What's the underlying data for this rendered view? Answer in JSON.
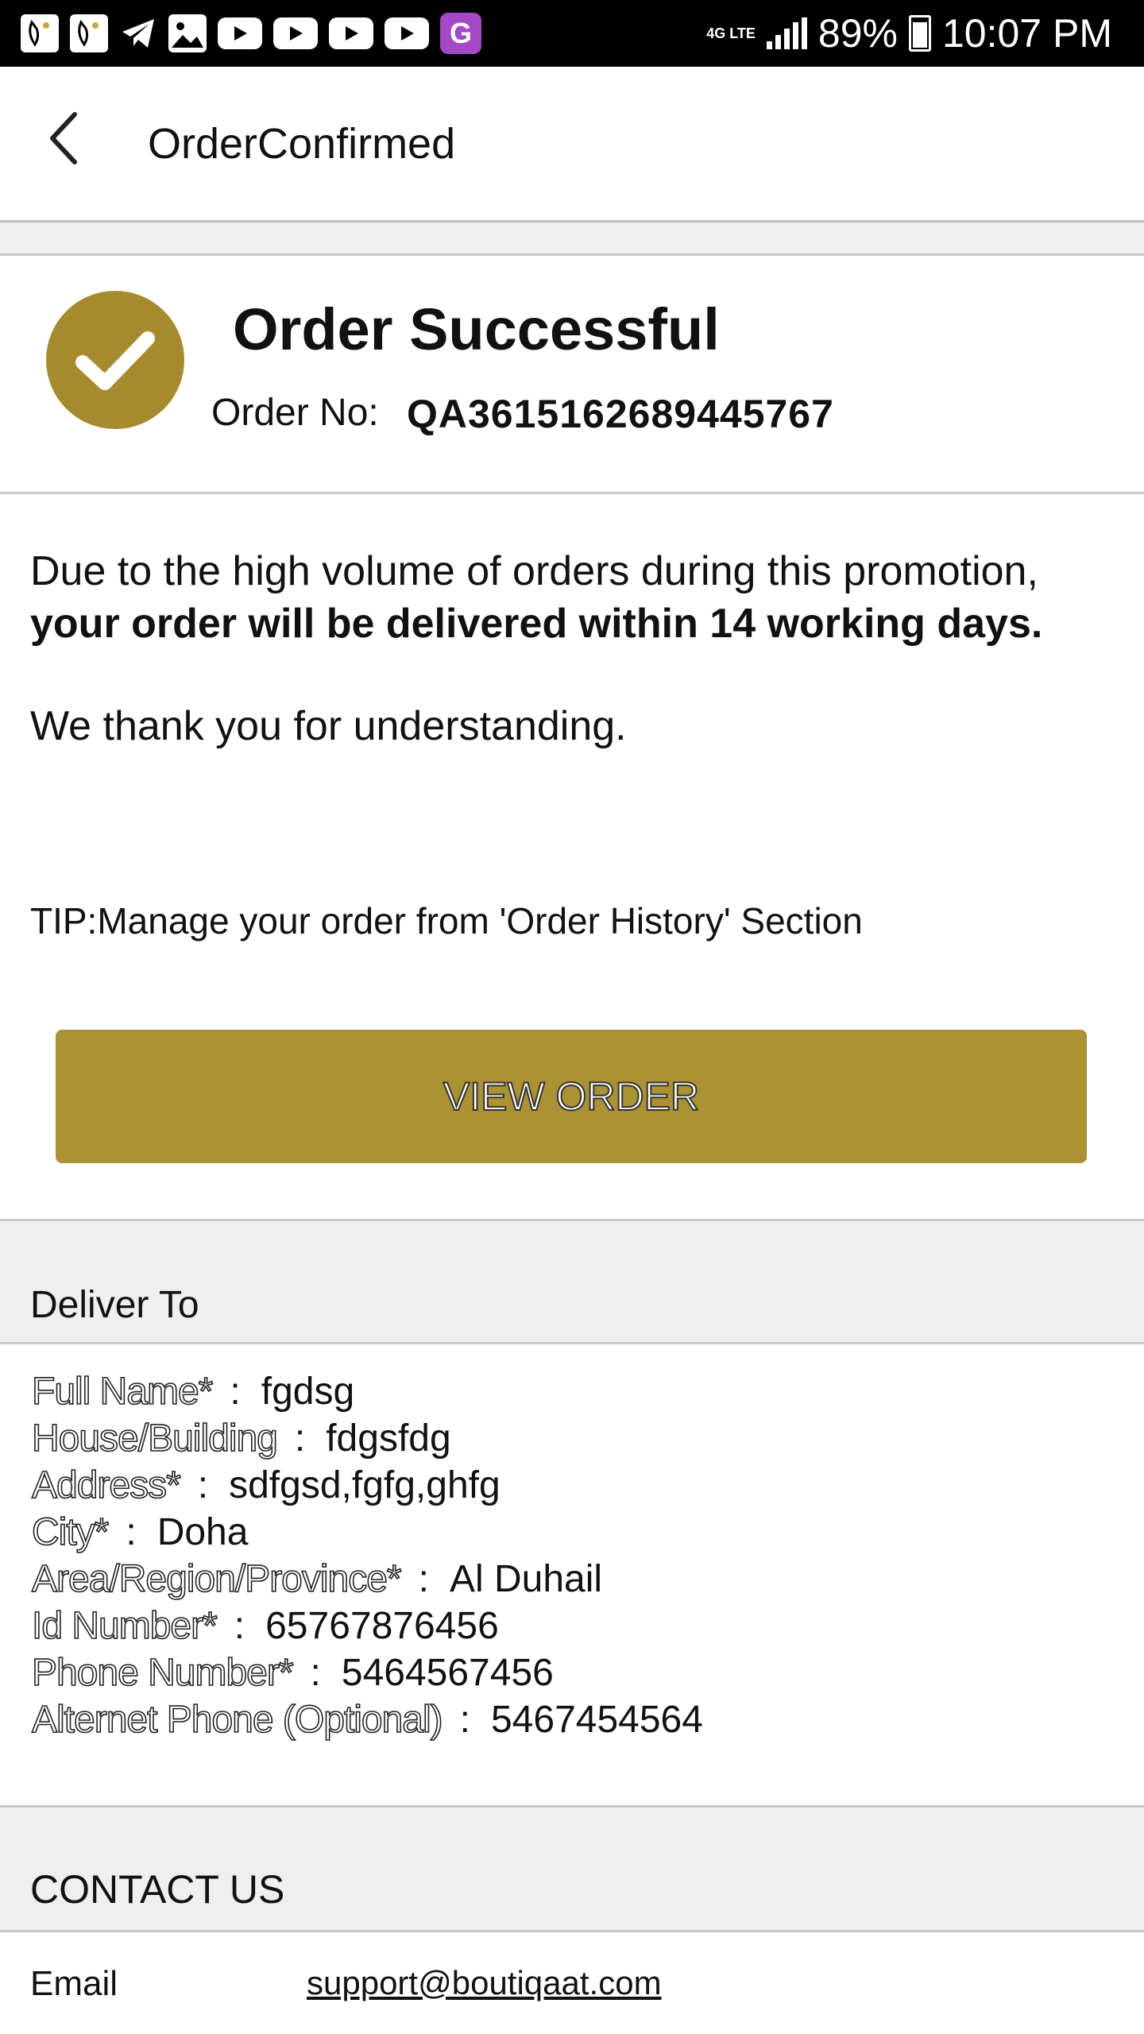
{
  "status_bar": {
    "left_icons": [
      "boutiqaat-app-icon",
      "boutiqaat-app-icon",
      "telegram-icon",
      "gallery-icon",
      "youtube-icon",
      "youtube-icon",
      "youtube-icon",
      "youtube-icon",
      "g-app-icon"
    ],
    "network": "4G LTE",
    "battery": "89%",
    "time": "10:07 PM"
  },
  "appbar": {
    "title": "OrderConfirmed",
    "back_icon": "back-arrow-icon"
  },
  "success": {
    "title": "Order Successful",
    "order_label": "Order No:",
    "order_number": "QA3615162689445767",
    "icon": "check-icon",
    "accent_color": "#a68b2e"
  },
  "message": {
    "line1": "Due to the high volume of orders during this promotion,",
    "line2_bold": "your order will be delivered within 14 working days.",
    "thanks": "We thank you for understanding."
  },
  "tip": "TIP:Manage your order from 'Order History' Section",
  "view_order_button": {
    "label": "VIEW ORDER",
    "color": "#ab9232"
  },
  "deliver_to": {
    "heading": "Deliver To",
    "fields": [
      {
        "label": "Full Name*",
        "value": "fgdsg"
      },
      {
        "label": "House/Building",
        "value": "fdgsfdg"
      },
      {
        "label": "Address*",
        "value": "sdfgsd,fgfg,ghfg"
      },
      {
        "label": "City*",
        "value": "Doha"
      },
      {
        "label": "Area/Region/Province*",
        "value": "Al Duhail"
      },
      {
        "label": "Id Number*",
        "value": "65767876456"
      },
      {
        "label": "Phone Number*",
        "value": "5464567456"
      },
      {
        "label": "Alternet Phone (Optional)",
        "value": "5467454564"
      }
    ]
  },
  "contact_us": {
    "heading": "CONTACT US",
    "email_label": "Email",
    "email": "support@boutiqaat.com"
  }
}
